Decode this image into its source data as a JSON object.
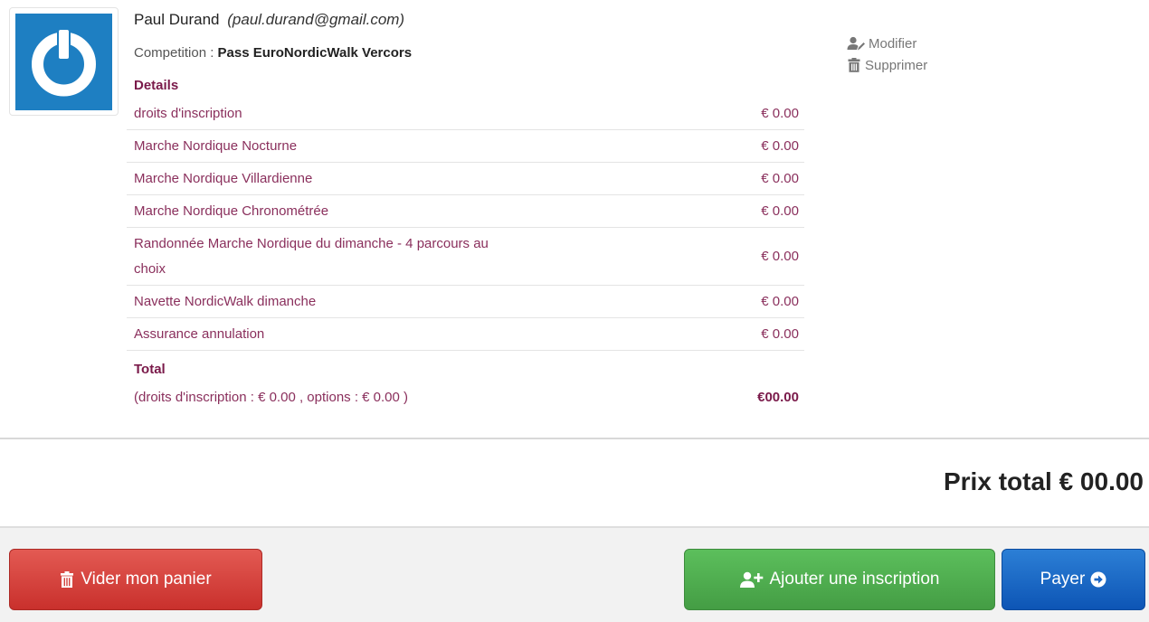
{
  "registration": {
    "name": "Paul Durand",
    "email": "(paul.durand@gmail.com)",
    "competition_label": "Competition : ",
    "competition_name": "Pass EuroNordicWalk Vercors",
    "details_title": "Details",
    "items": [
      {
        "label": "droits d'inscription",
        "price": "€ 0.00"
      },
      {
        "label": "Marche Nordique Nocturne",
        "price": "€ 0.00"
      },
      {
        "label": "Marche Nordique Villardienne",
        "price": "€ 0.00"
      },
      {
        "label": "Marche Nordique Chronométrée",
        "price": "€ 0.00"
      },
      {
        "label": "Randonnée Marche Nordique du dimanche - 4 parcours au choix",
        "price": "€ 0.00"
      },
      {
        "label": "Navette NordicWalk dimanche",
        "price": "€ 0.00"
      },
      {
        "label": "Assurance annulation",
        "price": "€ 0.00"
      }
    ],
    "total_title": "Total",
    "total_breakdown": "(droits d'inscription : € 0.00   , options : € 0.00  )",
    "total_value": "€00.00"
  },
  "actions": {
    "edit_label": "Modifier",
    "delete_label": "Supprimer"
  },
  "summary": {
    "grand_total": "Prix total € 00.00"
  },
  "buttons": {
    "empty_cart": "Vider mon panier",
    "add_registration": "Ajouter une inscription",
    "pay": "Payer"
  },
  "icons": {
    "avatar": "power-icon",
    "edit": "user-edit-icon",
    "delete": "trash-icon",
    "empty_cart": "trash-icon",
    "add_registration": "user-plus-icon",
    "pay": "arrow-circle-right-icon"
  },
  "colors": {
    "accent_text": "#8a2f5c",
    "avatar_bg": "#1e7fc2",
    "danger": "#d9534f",
    "success": "#5cb85c",
    "primary": "#1565c0"
  }
}
